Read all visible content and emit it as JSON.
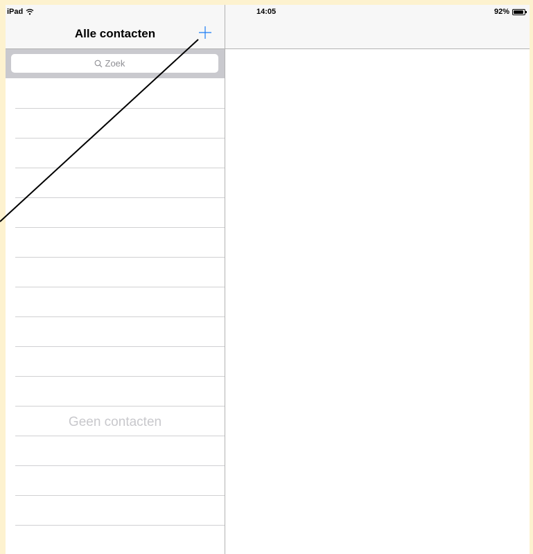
{
  "status_bar": {
    "device": "iPad",
    "time": "14:05",
    "battery_percent": "92%",
    "battery_level": 0.92,
    "wifi_icon": "wifi-icon"
  },
  "master": {
    "title": "Alle contacten",
    "add_icon": "plus-icon",
    "search": {
      "placeholder": "Zoek",
      "icon": "search-icon"
    },
    "empty_message": "Geen contacten"
  },
  "colors": {
    "accent": "#1a7cf5",
    "page_background": "#fdf2cf",
    "nav_background": "#f7f7f7",
    "search_bar_background": "#c9c9ce",
    "empty_text": "#c8c8cc",
    "callout_line": "#000000"
  }
}
